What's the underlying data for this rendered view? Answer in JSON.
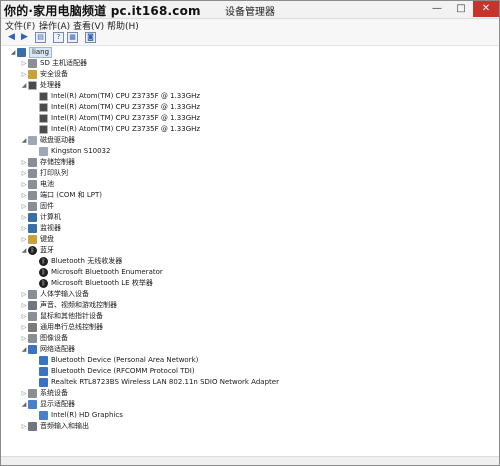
{
  "window": {
    "title": "设备管理器",
    "watermark": "你的·家用电脑频道 pc.it168.com",
    "controls": {
      "minimize": "—",
      "maximize": "□",
      "close": "✕"
    }
  },
  "menubar": {
    "items": [
      "文件(F)",
      "操作(A)",
      "查看(V)",
      "帮助(H)"
    ]
  },
  "toolbar": {
    "icons": [
      "back-arrow-icon",
      "forward-arrow-icon",
      "properties-icon",
      "help-icon",
      "view-icon",
      "device-icon"
    ]
  },
  "tree": {
    "root": "liang",
    "items": [
      {
        "label": "SD 主机适配器",
        "expander": "▷"
      },
      {
        "label": "安全设备",
        "expander": "▷"
      },
      {
        "label": "处理器",
        "expander": "◢"
      },
      {
        "label": "Intel(R) Atom(TM) CPU  Z3735F @ 1.33GHz"
      },
      {
        "label": "Intel(R) Atom(TM) CPU  Z3735F @ 1.33GHz"
      },
      {
        "label": "Intel(R) Atom(TM) CPU  Z3735F @ 1.33GHz"
      },
      {
        "label": "Intel(R) Atom(TM) CPU  Z3735F @ 1.33GHz"
      },
      {
        "label": "磁盘驱动器",
        "expander": "◢"
      },
      {
        "label": "Kingston S10032"
      },
      {
        "label": "存储控制器",
        "expander": "▷"
      },
      {
        "label": "打印队列",
        "expander": "▷"
      },
      {
        "label": "电池",
        "expander": "▷"
      },
      {
        "label": "端口 (COM 和 LPT)",
        "expander": "▷"
      },
      {
        "label": "固件",
        "expander": "▷"
      },
      {
        "label": "计算机",
        "expander": "▷"
      },
      {
        "label": "监视器",
        "expander": "▷"
      },
      {
        "label": "键盘",
        "expander": "▷"
      },
      {
        "label": "蓝牙",
        "expander": "◢"
      },
      {
        "label": "Bluetooth 无线收发器"
      },
      {
        "label": "Microsoft Bluetooth Enumerator"
      },
      {
        "label": "Microsoft Bluetooth LE 枚举器"
      },
      {
        "label": "人体学输入设备",
        "expander": "▷"
      },
      {
        "label": "声音、视频和游戏控制器",
        "expander": "▷"
      },
      {
        "label": "鼠标和其他指针设备",
        "expander": "▷"
      },
      {
        "label": "通用串行总线控制器",
        "expander": "▷"
      },
      {
        "label": "图像设备",
        "expander": "▷"
      },
      {
        "label": "网络适配器",
        "expander": "◢"
      },
      {
        "label": "Bluetooth Device (Personal Area Network)"
      },
      {
        "label": "Bluetooth Device (RFCOMM Protocol TDI)"
      },
      {
        "label": "Realtek RTL8723BS Wireless LAN 802.11n SDIO Network Adapter"
      },
      {
        "label": "系统设备",
        "expander": "▷"
      },
      {
        "label": "显示适配器",
        "expander": "◢"
      },
      {
        "label": "Intel(R) HD Graphics"
      },
      {
        "label": "音频输入和输出",
        "expander": "▷"
      }
    ]
  }
}
